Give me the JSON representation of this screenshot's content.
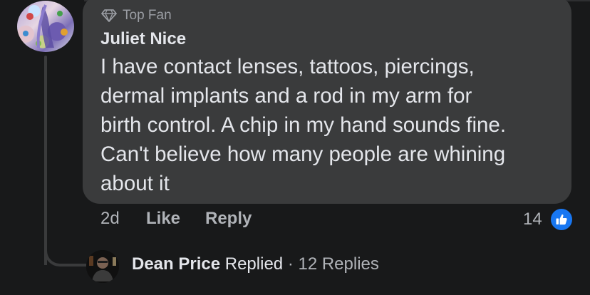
{
  "comment": {
    "badge": "Top Fan",
    "author": "Juliet Nice",
    "text": "I have contact lenses, tattoos, piercings,\ndermal implants and a rod in my arm for\nbirth control. A chip in my hand sounds fine.\nCan't believe how many people are whining\nabout it"
  },
  "actions": {
    "time": "2d",
    "like": "Like",
    "reply": "Reply",
    "reaction_count": "14",
    "reaction_icon": "thumbs-up-icon"
  },
  "replies": {
    "name": "Dean Price",
    "replied": "Replied",
    "separator": "·",
    "count": "12 Replies"
  },
  "colors": {
    "background": "#18191a",
    "bubble": "#3a3b3c",
    "like_blue": "#1877f2"
  }
}
